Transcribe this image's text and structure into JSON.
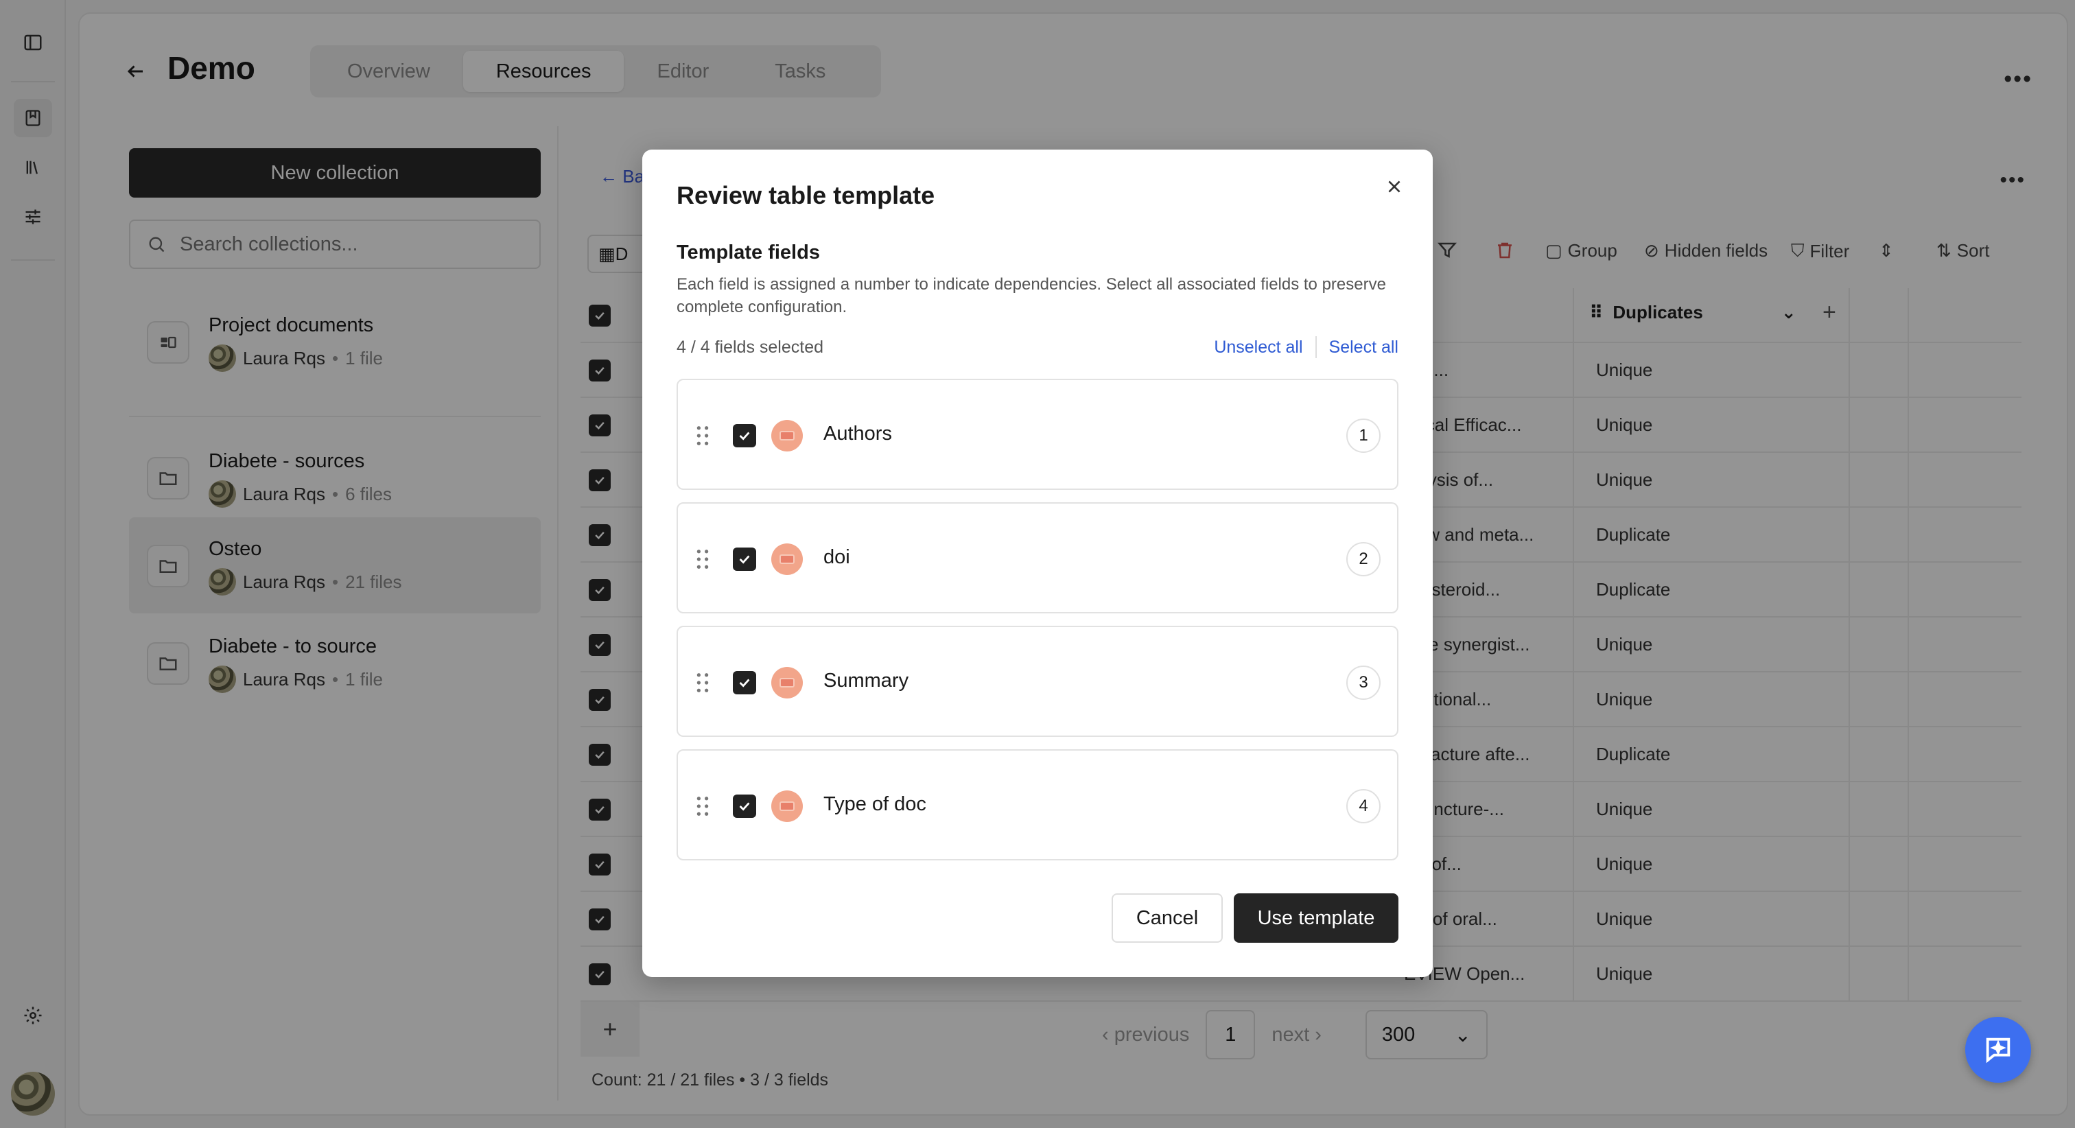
{
  "header": {
    "title": "Demo",
    "tabs": [
      {
        "label": "Overview",
        "active": false
      },
      {
        "label": "Resources",
        "active": true
      },
      {
        "label": "Editor",
        "active": false
      },
      {
        "label": "Tasks",
        "active": false
      }
    ]
  },
  "collections": {
    "new_button": "New collection",
    "search_placeholder": "Search collections...",
    "items": [
      {
        "name": "Project documents",
        "owner": "Laura Rqs",
        "count": "1 file",
        "icon": "project-icon",
        "active": false
      },
      {
        "name": "Diabete - sources",
        "owner": "Laura Rqs",
        "count": "6 files",
        "icon": "folder-icon",
        "active": false
      },
      {
        "name": "Osteo",
        "owner": "Laura Rqs",
        "count": "21 files",
        "icon": "folder-icon",
        "active": true
      },
      {
        "name": "Diabete - to source",
        "owner": "Laura Rqs",
        "count": "1 file",
        "icon": "folder-icon",
        "active": false
      }
    ]
  },
  "table": {
    "back_label": "Ba",
    "view_label": "D",
    "toolbar": {
      "group": "Group",
      "hidden_fields": "Hidden fields",
      "filter": "Filter",
      "sort": "Sort"
    },
    "dup_header": "Duplicates",
    "rows": [
      {
        "title": "and...",
        "dup": "Unique"
      },
      {
        "title": "linical Efficac...",
        "dup": "Unique"
      },
      {
        "title": "nalysis of...",
        "dup": "Unique"
      },
      {
        "title": "view and meta...",
        "dup": "Duplicate"
      },
      {
        "title": "lse steroid...",
        "dup": "Duplicate"
      },
      {
        "title": "f the synergist...",
        "dup": "Unique"
      },
      {
        "title": "raditional...",
        "dup": "Unique"
      },
      {
        "title": "refracture afte...",
        "dup": "Duplicate"
      },
      {
        "title": "upuncture-...",
        "dup": "Unique"
      },
      {
        "title": "cts of...",
        "dup": "Unique"
      },
      {
        "title": "ety of oral...",
        "dup": "Unique"
      },
      {
        "title": "EVIEW Open...",
        "dup": "Unique"
      }
    ],
    "pager": {
      "previous": "previous",
      "page": "1",
      "next": "next",
      "page_size": "300"
    },
    "count_line": "Count: 21 / 21 files • 3 / 3 fields"
  },
  "modal": {
    "title": "Review table template",
    "subtitle": "Template fields",
    "description": "Each field is assigned a number to indicate dependencies. Select all associated fields to preserve complete configuration.",
    "selected": "4 / 4 fields selected",
    "unselect_all": "Unselect all",
    "select_all": "Select all",
    "fields": [
      {
        "name": "Authors",
        "number": "1",
        "checked": true
      },
      {
        "name": "doi",
        "number": "2",
        "checked": true
      },
      {
        "name": "Summary",
        "number": "3",
        "checked": true
      },
      {
        "name": "Type of doc",
        "number": "4",
        "checked": true
      }
    ],
    "cancel": "Cancel",
    "use_template": "Use template"
  },
  "colors": {
    "accent": "#3d6ff0",
    "link": "#2f5bd3",
    "field_icon": "#f2a58a",
    "dark_button": "#252525"
  }
}
